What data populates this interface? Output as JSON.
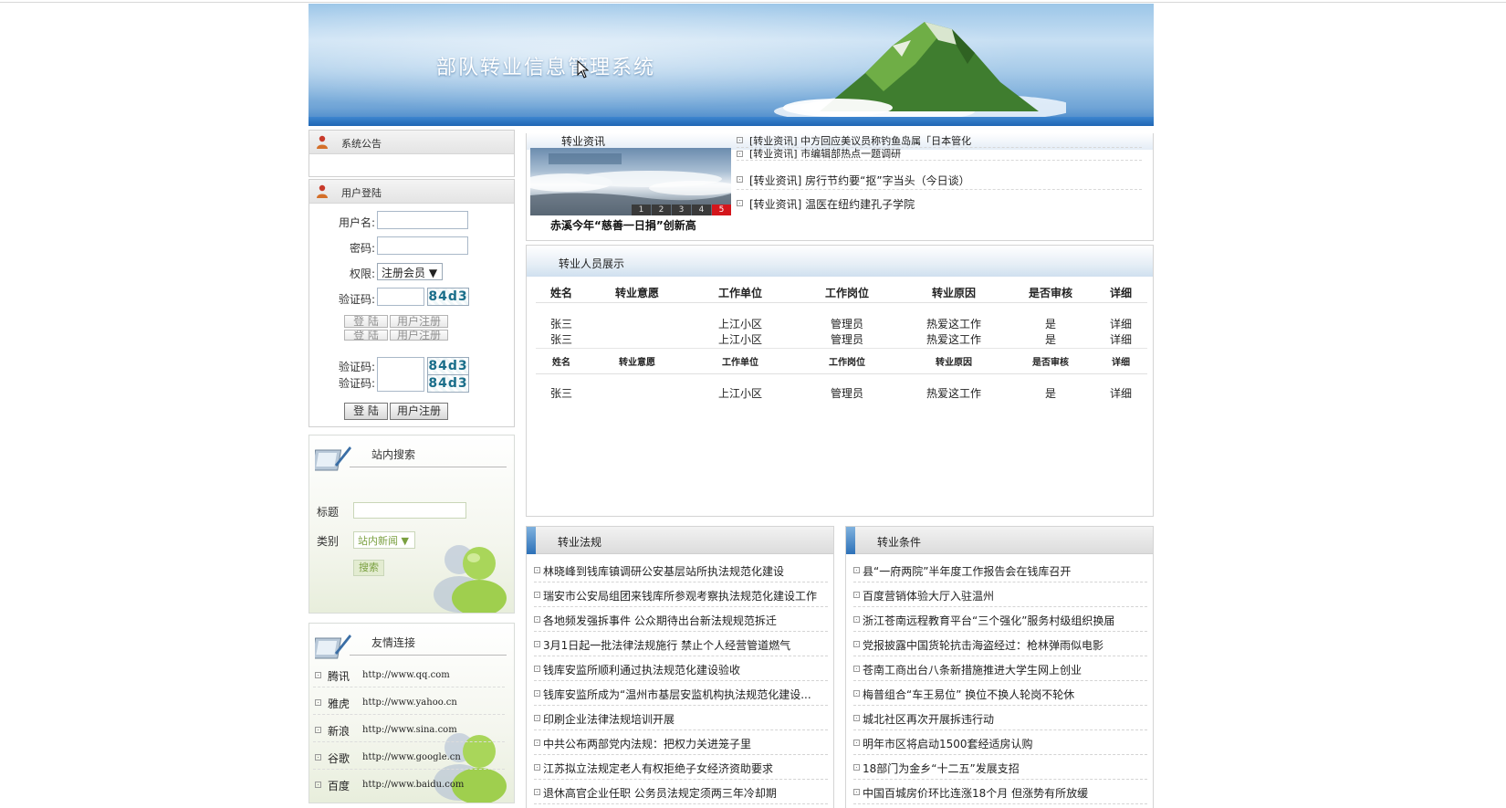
{
  "header": {
    "title": "部队转业信息管理系统"
  },
  "notice": {
    "title": "系统公告"
  },
  "login": {
    "title": "用户登陆",
    "username_label": "用户名:",
    "password_label": "密码:",
    "role_label": "权限:",
    "role_value": "注册会员 ▼",
    "captcha_label": "验证码:",
    "captcha_code": "84d3",
    "login_button": "登 陆",
    "register_button": "用户注册"
  },
  "search": {
    "title": "站内搜索",
    "title_label": "标题",
    "category_label": "类别",
    "category_value": "站内新闻 ▼",
    "search_button": "搜索"
  },
  "links": {
    "title": "友情连接",
    "items": [
      {
        "name": "腾讯",
        "url": "http://www.qq.com"
      },
      {
        "name": "雅虎",
        "url": "http://www.yahoo.cn"
      },
      {
        "name": "新浪",
        "url": "http://www.sina.com"
      },
      {
        "name": "谷歌",
        "url": "http://www.google.cn"
      },
      {
        "name": "百度",
        "url": "http://www.baidu.com"
      }
    ]
  },
  "news": {
    "title": "转业资讯",
    "slide_caption": "赤溪今年“慈善一日捐”创新高",
    "slide_numbers": [
      "1",
      "2",
      "3",
      "4",
      "5"
    ],
    "items": [
      "[转业资讯] 中方回应美议员称钓鱼岛属「日本管化",
      "[转业资讯] 市编辑部热点一题调研",
      "[转业资讯] 房行节约要“抠”字当头（今日谈）",
      "[转业资讯] 温医在纽约建孔子学院"
    ]
  },
  "personnel": {
    "title": "转业人员展示",
    "columns": [
      "姓名",
      "转业意愿",
      "工作单位",
      "工作岗位",
      "转业原因",
      "是否审核",
      "详细"
    ],
    "rows": [
      [
        "张三",
        "",
        "上江小区",
        "管理员",
        "热爱这工作",
        "是",
        "详细"
      ],
      [
        "张三",
        "",
        "上江小区",
        "管理员",
        "热爱这工作",
        "是",
        "详细"
      ]
    ],
    "last_row": [
      "张三",
      "",
      "上江小区",
      "管理员",
      "热爱这工作",
      "是",
      "详细"
    ]
  },
  "laws": {
    "title": "转业法规",
    "items": [
      "林晓峰到钱库镇调研公安基层站所执法规范化建设",
      "瑞安市公安局组团来钱库所参观考察执法规范化建设工作",
      "各地频发强拆事件 公众期待出台新法规规范拆迁",
      "3月1日起一批法律法规施行 禁止个人经营管道燃气",
      "钱库安监所顺利通过执法规范化建设验收",
      "钱库安监所成为“温州市基层安监机构执法规范化建设...",
      "印刷企业法律法规培训开展",
      "中共公布两部党内法规：把权力关进笼子里",
      "江苏拟立法规定老人有权拒绝子女经济资助要求",
      "退休高官企业任职 公务员法规定须两三年冷却期"
    ]
  },
  "conditions": {
    "title": "转业条件",
    "items": [
      "县“一府两院”半年度工作报告会在钱库召开",
      "百度营销体验大厅入驻温州",
      "浙江苍南远程教育平台“三个强化”服务村级组织换届",
      "党报披露中国货轮抗击海盗经过：枪林弹雨似电影",
      "苍南工商出台八条新措施推进大学生网上创业",
      "梅普组合“车王易位” 换位不换人轮岗不轮休",
      "城北社区再次开展拆违行动",
      "明年市区将启动1500套经适房认购",
      "18部门为金乡“十二五”发展支招",
      "中国百城房价环比连涨18个月 但涨势有所放缓"
    ]
  },
  "colors": {
    "banner_blue": "#3d7fc6",
    "captcha_text": "#1a6e8a",
    "slide_active": "#d4161c"
  }
}
